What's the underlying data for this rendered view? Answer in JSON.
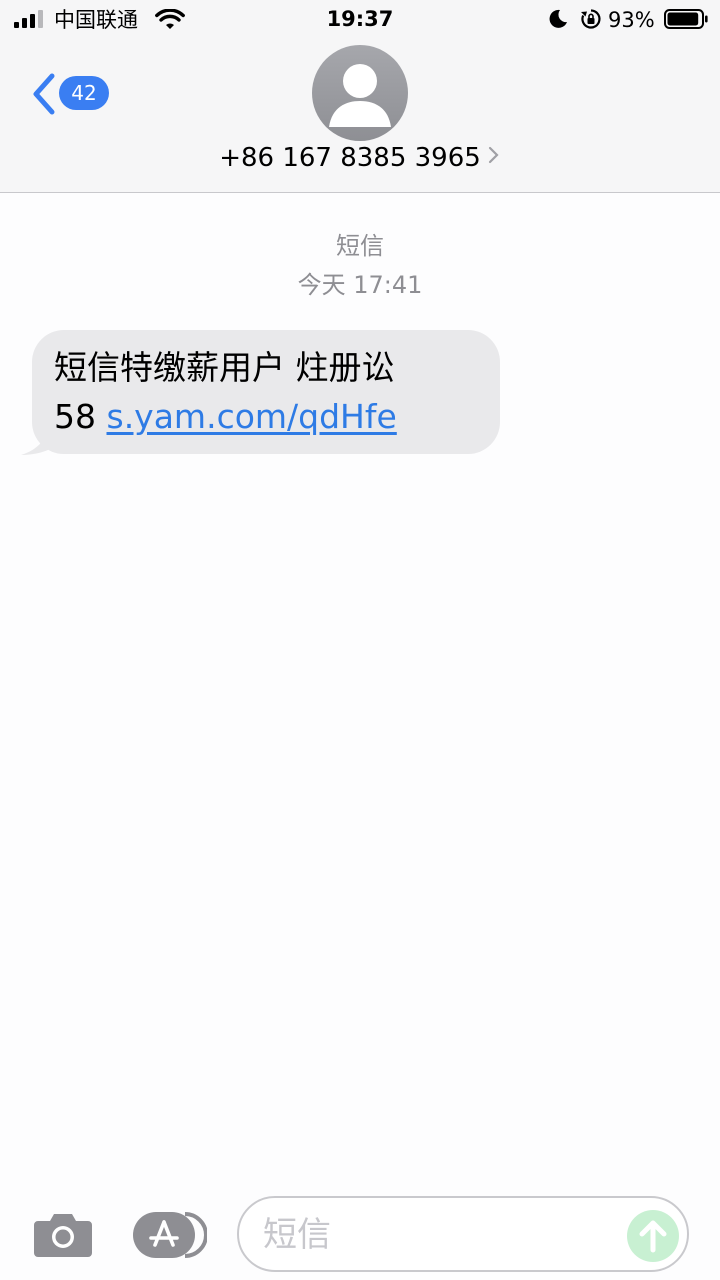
{
  "status_bar": {
    "carrier": "中国联通",
    "time": "19:37",
    "battery_percent": "93%",
    "battery_level": 0.93,
    "icons": [
      "signal-icon",
      "wifi-icon",
      "moon-icon",
      "rotation-lock-icon",
      "battery-icon"
    ]
  },
  "header": {
    "back_count": "42",
    "contact": "+86 167 8385 3965",
    "icons": [
      "chevron-left-icon",
      "avatar-icon",
      "chevron-right-icon"
    ]
  },
  "conversation": {
    "service": "短信",
    "timestamp": "今天 17:41",
    "messages": [
      {
        "direction": "incoming",
        "line1": "短信特缴薪用户 炷册讼",
        "line2_prefix": "58",
        "link": "s.yam.com/qdHfe"
      }
    ]
  },
  "composer": {
    "placeholder": "短信",
    "icons": [
      "camera-icon",
      "app-store-icon",
      "send-arrow-icon"
    ]
  },
  "colors": {
    "accent": "#3a7ef2",
    "link": "#2e7be5",
    "bubble": "#e9e9eb",
    "muted": "#8e8e93",
    "send_disabled": "#c8f0d2"
  }
}
